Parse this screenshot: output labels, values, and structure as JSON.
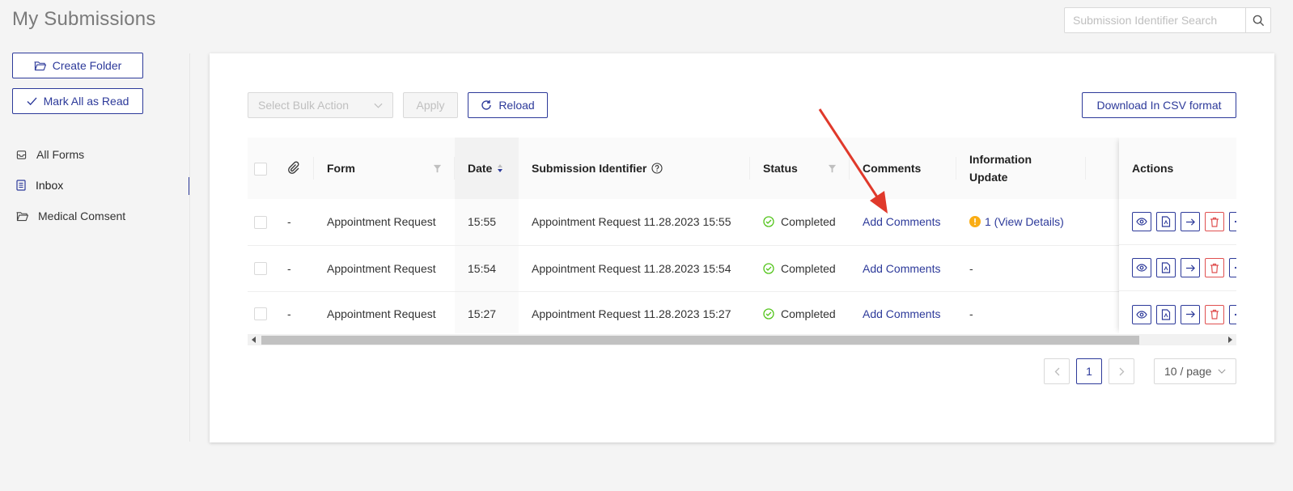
{
  "page": {
    "title": "My Submissions"
  },
  "search": {
    "placeholder": "Submission Identifier Search"
  },
  "sidebar": {
    "create_folder": "Create Folder",
    "mark_all_read": "Mark All as Read",
    "items": [
      {
        "label": "All Forms",
        "icon": "all-forms-icon"
      },
      {
        "label": "Inbox",
        "icon": "inbox-icon",
        "active": true
      },
      {
        "label": "Medical Comsent",
        "icon": "folder-icon"
      }
    ]
  },
  "toolbar": {
    "bulk_placeholder": "Select Bulk Action",
    "apply": "Apply",
    "reload": "Reload",
    "csv": "Download In CSV format"
  },
  "table": {
    "headers": {
      "form": "Form",
      "date": "Date",
      "identifier": "Submission Identifier",
      "status": "Status",
      "comments": "Comments",
      "info_update": "Information Update",
      "actions": "Actions"
    },
    "rows": [
      {
        "attach": "-",
        "form": "Appointment Request",
        "date": "15:55",
        "identifier": "Appointment Request 11.28.2023 15:55",
        "status": "Completed",
        "comments": "Add Comments",
        "info": "1 (View Details)",
        "info_warning": true
      },
      {
        "attach": "-",
        "form": "Appointment Request",
        "date": "15:54",
        "identifier": "Appointment Request 11.28.2023 15:54",
        "status": "Completed",
        "comments": "Add Comments",
        "info": "-",
        "info_warning": false
      },
      {
        "attach": "-",
        "form": "Appointment Request",
        "date": "15:27",
        "identifier": "Appointment Request 11.28.2023 15:27",
        "status": "Completed",
        "comments": "Add Comments",
        "info": "-",
        "info_warning": false
      }
    ]
  },
  "pagination": {
    "current": "1",
    "page_size": "10 / page"
  },
  "colors": {
    "accent": "#2d3a9a",
    "success": "#52c41a",
    "warning": "#faad14",
    "danger": "#e05050",
    "annotation_arrow": "#e0392b"
  }
}
